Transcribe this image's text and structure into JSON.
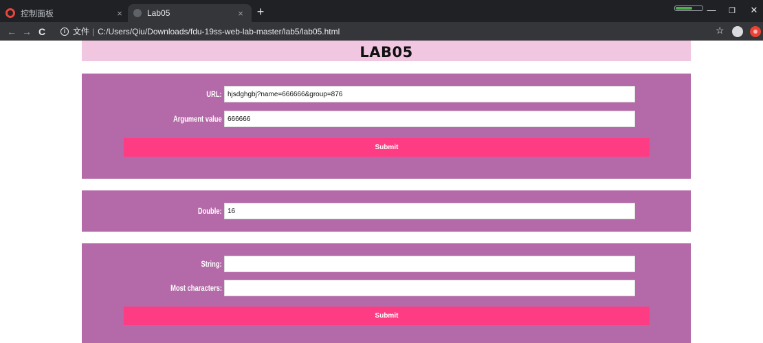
{
  "browser": {
    "tabs": [
      {
        "title": "控制面板",
        "close": "×"
      },
      {
        "title": "Lab05",
        "close": "×"
      }
    ],
    "new_tab": "+",
    "memory_level": 0.6,
    "window_controls": {
      "minimize": "—",
      "maximize": "❐",
      "close": "✕"
    },
    "nav": {
      "back": "←",
      "forward": "→",
      "reload": "C"
    },
    "address": {
      "info_glyph": "i",
      "scheme_label": "文件",
      "separator": "|",
      "url": "C:/Users/Qiu/Downloads/fdu-19ss-web-lab-master/lab5/lab05.html"
    },
    "bookmark_star": "☆"
  },
  "page": {
    "title": "LAB05",
    "url_form": {
      "url_label": "URL:",
      "url_value": "hjsdghgbj?name=666666&group=876",
      "argument_label": "Argument value",
      "argument_value": "666666",
      "submit_label": "Submit"
    },
    "double_form": {
      "double_label": "Double:",
      "double_value": "16"
    },
    "string_form": {
      "string_label": "String:",
      "string_value": "",
      "most_label": "Most characters:",
      "most_value": "",
      "submit_label": "Submit"
    }
  },
  "colors": {
    "header_bg": "#f0c6e0",
    "panel_bg": "#b46aa8",
    "submit_bg": "#fe3c84",
    "chrome_dark": "#202124",
    "chrome_toolbar": "#35363a"
  }
}
